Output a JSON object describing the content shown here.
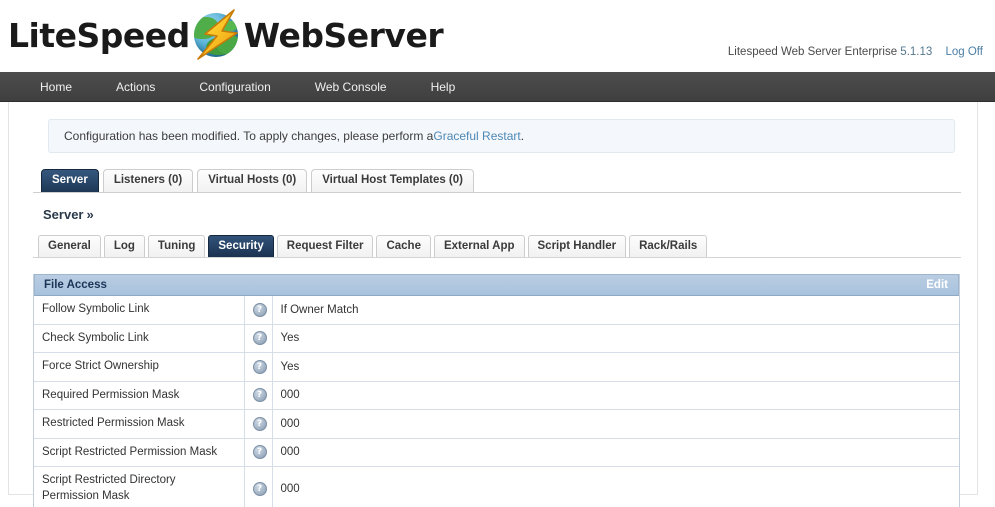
{
  "header": {
    "logo_left": "LiteSpeed",
    "logo_right": "WebServer",
    "logo_icon": "litespeed-globe-bolt-logo",
    "product_name": "Litespeed Web Server Enterprise",
    "version": "5.1.13",
    "logoff_label": "Log Off"
  },
  "nav": {
    "items": [
      {
        "label": "Home"
      },
      {
        "label": "Actions"
      },
      {
        "label": "Configuration"
      },
      {
        "label": "Web Console"
      },
      {
        "label": "Help"
      }
    ]
  },
  "notice": {
    "text_before": "Configuration has been modified. To apply changes, please perform a ",
    "link_label": "Graceful Restart",
    "text_after": "."
  },
  "primary_tabs": {
    "items": [
      {
        "label": "Server",
        "active": true
      },
      {
        "label": "Listeners (0)",
        "active": false
      },
      {
        "label": "Virtual Hosts (0)",
        "active": false
      },
      {
        "label": "Virtual Host Templates (0)",
        "active": false
      }
    ]
  },
  "breadcrumb": {
    "label": "Server",
    "chevron": "»"
  },
  "sub_tabs": {
    "items": [
      {
        "label": "General",
        "active": false
      },
      {
        "label": "Log",
        "active": false
      },
      {
        "label": "Tuning",
        "active": false
      },
      {
        "label": "Security",
        "active": true
      },
      {
        "label": "Request Filter",
        "active": false
      },
      {
        "label": "Cache",
        "active": false
      },
      {
        "label": "External App",
        "active": false
      },
      {
        "label": "Script Handler",
        "active": false
      },
      {
        "label": "Rack/Rails",
        "active": false
      }
    ]
  },
  "section": {
    "title": "File Access",
    "edit_label": "Edit",
    "help_glyph": "?",
    "rows": [
      {
        "label": "Follow Symbolic Link",
        "value": "If Owner Match"
      },
      {
        "label": "Check Symbolic Link",
        "value": "Yes"
      },
      {
        "label": "Force Strict Ownership",
        "value": "Yes"
      },
      {
        "label": "Required Permission Mask",
        "value": "000"
      },
      {
        "label": "Restricted Permission Mask",
        "value": "000"
      },
      {
        "label": "Script Restricted Permission Mask",
        "value": "000"
      },
      {
        "label": "Script Restricted Directory Permission Mask",
        "value": "000"
      }
    ]
  },
  "colors": {
    "navbar_bg": "#464646",
    "active_tab": "#1d3755",
    "section_head": "#a8c2dd",
    "link": "#4e88b5",
    "notice_bg": "#f4f7fb"
  }
}
